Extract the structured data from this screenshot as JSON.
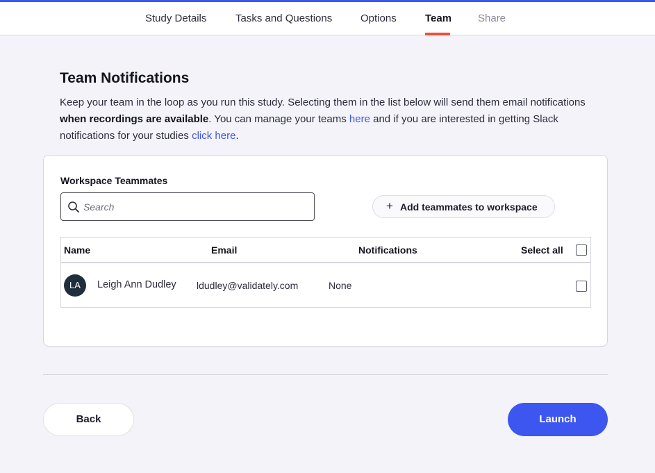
{
  "nav": {
    "tabs": [
      {
        "label": "Study Details"
      },
      {
        "label": "Tasks and Questions"
      },
      {
        "label": "Options"
      },
      {
        "label": "Team"
      },
      {
        "label": "Share"
      }
    ],
    "active_tab": "Team"
  },
  "section": {
    "title": "Team Notifications",
    "intro_part1": "Keep your team in the loop as you run this study. Selecting them in the list below will send them email notifications ",
    "intro_bold": "when recordings are available",
    "intro_part2": ". You can manage your teams ",
    "link_here": "here",
    "intro_part3": " and if you are interested in getting Slack notifications for your studies ",
    "link_click_here": "click here",
    "intro_end": "."
  },
  "workspace": {
    "label": "Workspace Teammates",
    "search_placeholder": "Search",
    "add_button_label": "Add teammates to workspace",
    "table": {
      "headers": {
        "name": "Name",
        "email": "Email",
        "notifications": "Notifications",
        "select_all": "Select all"
      },
      "rows": [
        {
          "initials": "LA",
          "name": "Leigh Ann Dudley",
          "email": "ldudley@validately.com",
          "notifications": "None",
          "selected": false
        }
      ]
    }
  },
  "footer": {
    "back_label": "Back",
    "launch_label": "Launch"
  },
  "colors": {
    "accent": "#3d56f0",
    "tab_underline": "#f04d3a",
    "avatar_bg": "#1e2e3c"
  }
}
